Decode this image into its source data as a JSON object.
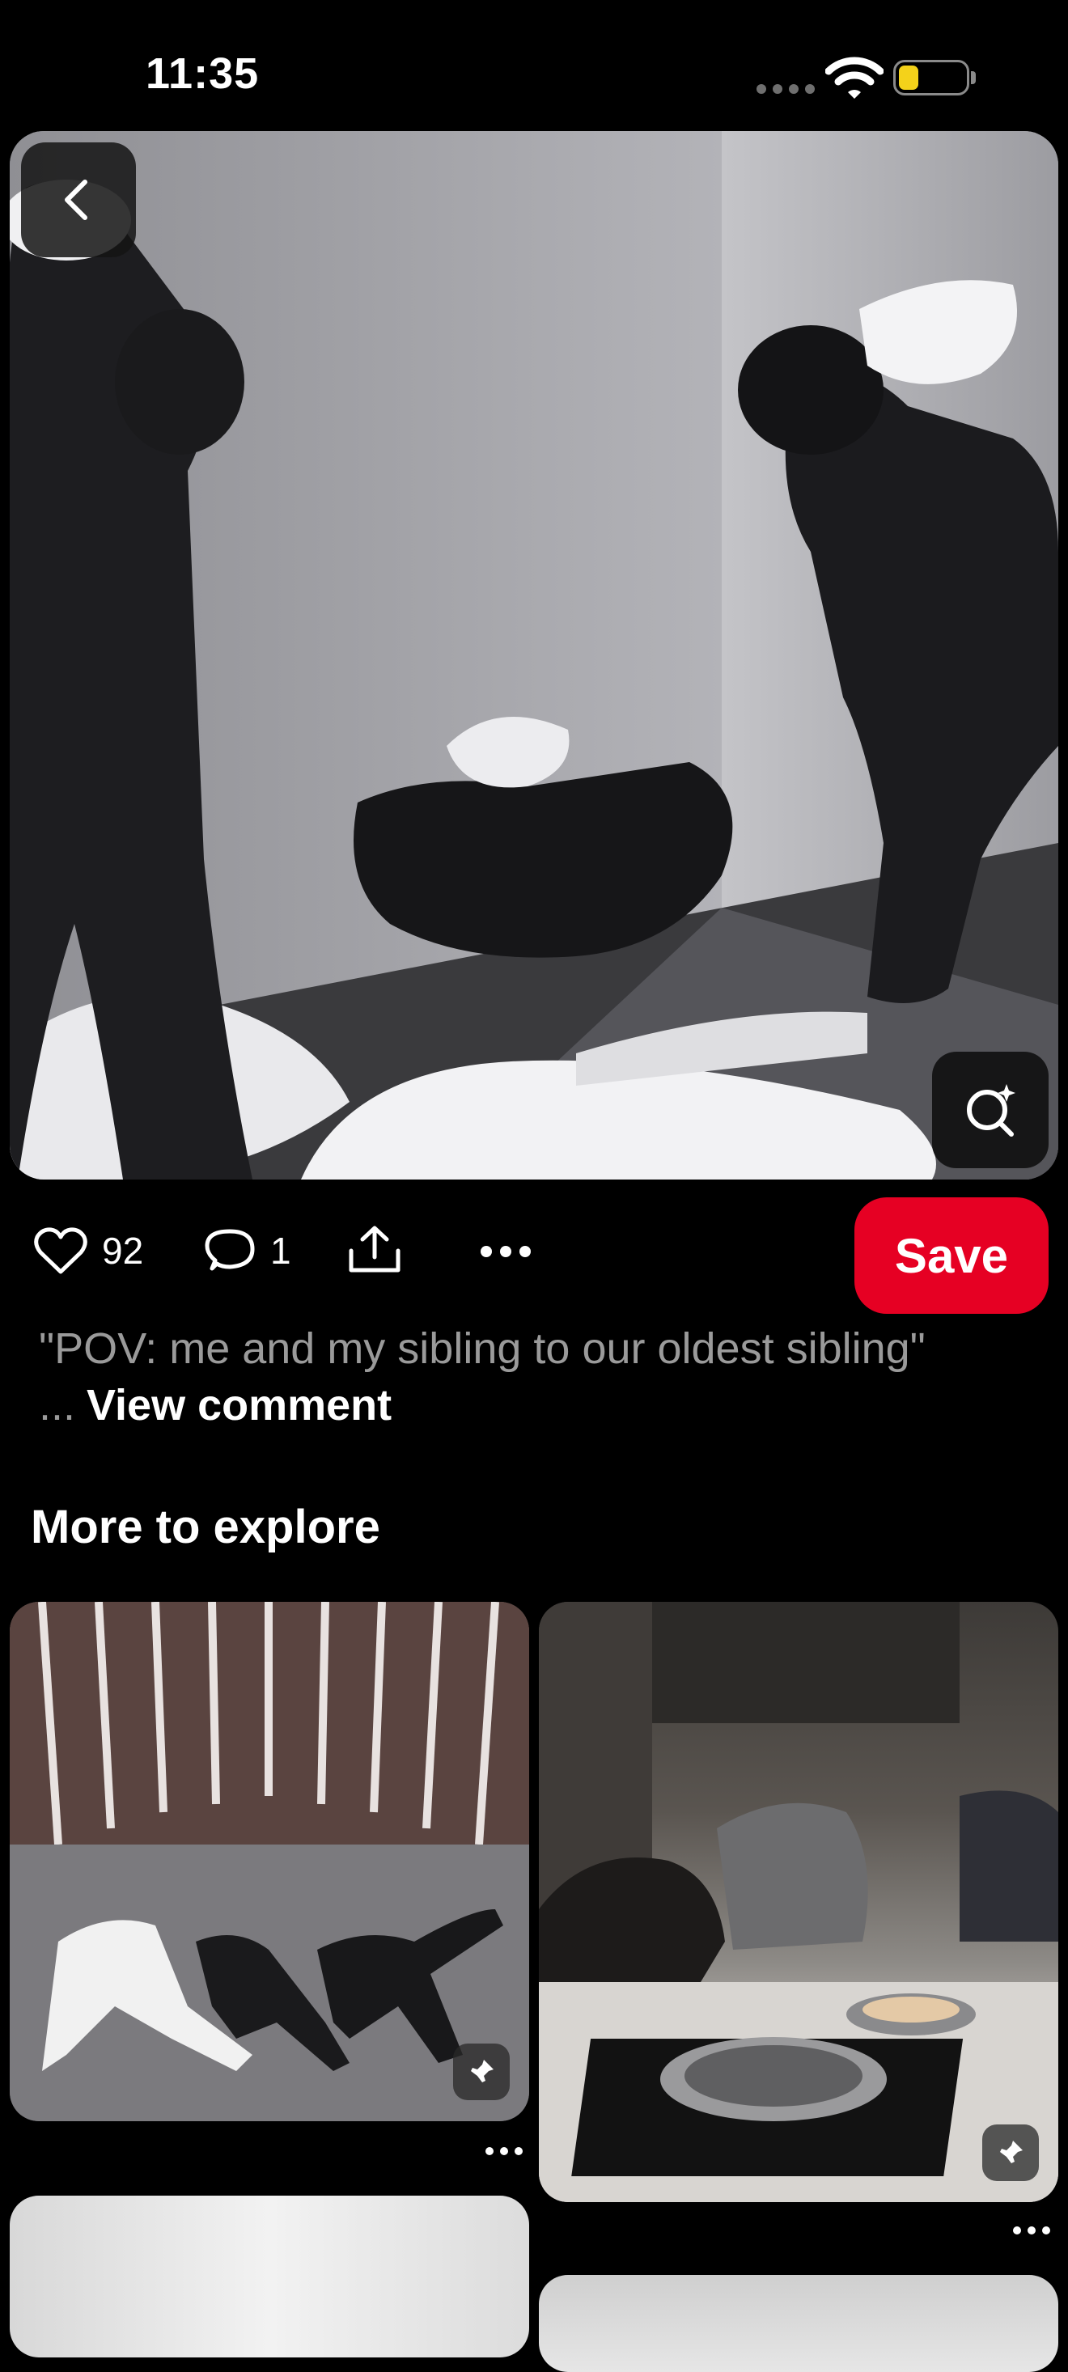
{
  "status_bar": {
    "time": "11:35"
  },
  "pin": {
    "likes": "92",
    "comments": "1",
    "save_label": "Save",
    "description": "\"POV: me and my sibling to our oldest sibling\" ...",
    "view_comment": "View comment"
  },
  "explore": {
    "title": "More to explore"
  },
  "icons": {
    "back": "chevron-left-icon",
    "visual_search": "visual-search-icon",
    "like": "heart-icon",
    "comment": "comment-bubble-icon",
    "share": "share-icon",
    "more": "more-dots-icon",
    "pinned": "pin-icon"
  },
  "colors": {
    "save_button": "#e60023",
    "background": "#000000",
    "battery": "#f4d21a"
  }
}
